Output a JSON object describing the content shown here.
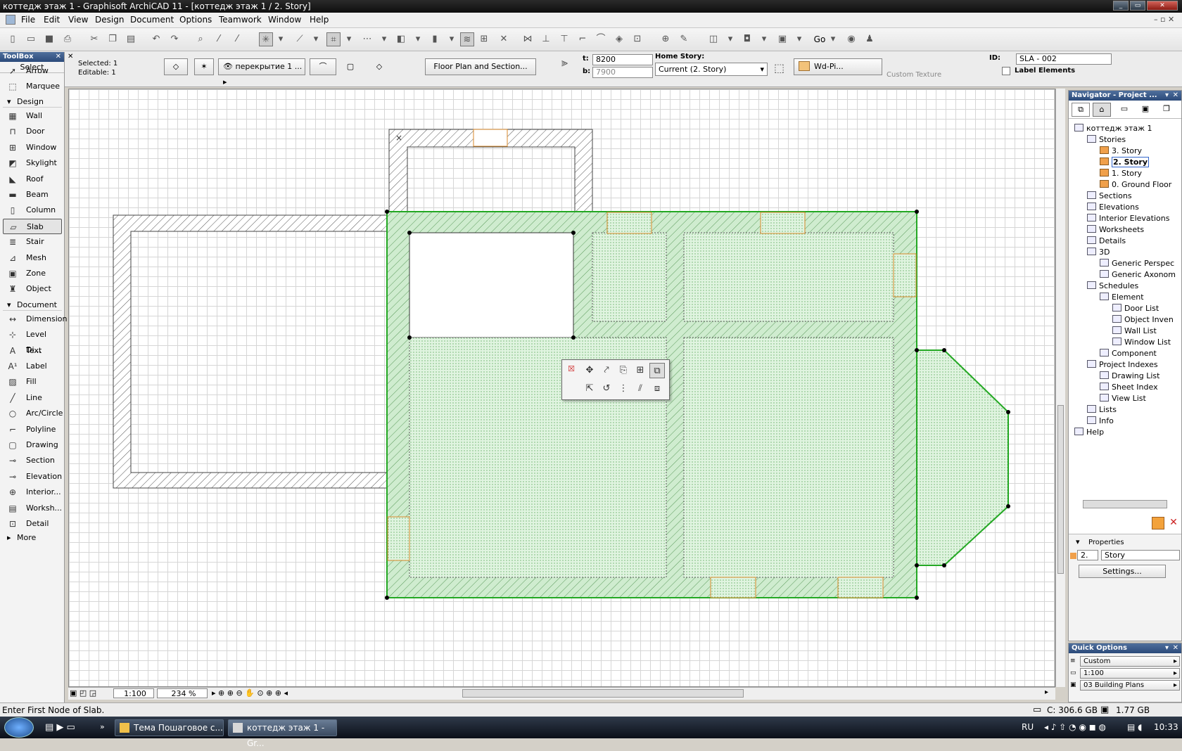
{
  "window": {
    "title": "коттедж этаж 1 - Graphisoft ArchiCAD 11 - [коттедж этаж 1 / 2. Story]"
  },
  "menu": [
    "File",
    "Edit",
    "View",
    "Design",
    "Document",
    "Options",
    "Teamwork",
    "Window",
    "Help"
  ],
  "toolbar": {
    "go_label": "Go"
  },
  "infobox": {
    "selected": "Selected: 1",
    "editable": "Editable: 1",
    "layer": "перекрытие 1 ...",
    "floor_plan_button": "Floor Plan and Section...",
    "t_label": "t:",
    "t_value": "8200",
    "b_label": "b:",
    "b_value": "7900",
    "home_story_label": "Home Story:",
    "home_story_value": "Current (2. Story)",
    "material": "Wd-Pi...",
    "custom_texture": "Custom Texture",
    "id_label": "ID:",
    "id_value": "SLA - 002",
    "label_elements": "Label Elements"
  },
  "toolbox": {
    "title": "ToolBox",
    "select": "Select",
    "select_tools": [
      {
        "label": "Arrow",
        "icon": "arrow-icon"
      },
      {
        "label": "Marquee",
        "icon": "marquee-icon"
      }
    ],
    "design_group": "Design",
    "design_tools": [
      {
        "label": "Wall",
        "icon": "wall-icon"
      },
      {
        "label": "Door",
        "icon": "door-icon"
      },
      {
        "label": "Window",
        "icon": "window-icon"
      },
      {
        "label": "Skylight",
        "icon": "skylight-icon"
      },
      {
        "label": "Roof",
        "icon": "roof-icon"
      },
      {
        "label": "Beam",
        "icon": "beam-icon"
      },
      {
        "label": "Column",
        "icon": "column-icon"
      },
      {
        "label": "Slab",
        "icon": "slab-icon"
      },
      {
        "label": "Stair",
        "icon": "stair-icon"
      },
      {
        "label": "Mesh",
        "icon": "mesh-icon"
      },
      {
        "label": "Zone",
        "icon": "zone-icon"
      },
      {
        "label": "Object",
        "icon": "object-icon"
      }
    ],
    "document_group": "Document",
    "document_tools": [
      {
        "label": "Dimension",
        "icon": "dimension-icon"
      },
      {
        "label": "Level Di...",
        "icon": "level-dimension-icon"
      },
      {
        "label": "Text",
        "icon": "text-icon"
      },
      {
        "label": "Label",
        "icon": "label-icon"
      },
      {
        "label": "Fill",
        "icon": "fill-icon"
      },
      {
        "label": "Line",
        "icon": "line-icon"
      },
      {
        "label": "Arc/Circle",
        "icon": "arc-circle-icon"
      },
      {
        "label": "Polyline",
        "icon": "polyline-icon"
      },
      {
        "label": "Drawing",
        "icon": "drawing-icon"
      },
      {
        "label": "Section",
        "icon": "section-icon"
      },
      {
        "label": "Elevation",
        "icon": "elevation-icon"
      },
      {
        "label": "Interior...",
        "icon": "interior-elevation-icon"
      },
      {
        "label": "Worksh...",
        "icon": "worksheet-icon"
      },
      {
        "label": "Detail",
        "icon": "detail-icon"
      }
    ],
    "more": "More"
  },
  "navigator": {
    "title": "Navigator - Project ...",
    "items": [
      {
        "label": "коттедж этаж 1"
      },
      {
        "label": "Stories"
      },
      {
        "label": "3. Story"
      },
      {
        "label": "2. Story"
      },
      {
        "label": "1. Story"
      },
      {
        "label": "0. Ground Floor"
      },
      {
        "label": "Sections"
      },
      {
        "label": "Elevations"
      },
      {
        "label": "Interior Elevations"
      },
      {
        "label": "Worksheets"
      },
      {
        "label": "Details"
      },
      {
        "label": "3D"
      },
      {
        "label": "Generic Perspec"
      },
      {
        "label": "Generic Axonom"
      },
      {
        "label": "Schedules"
      },
      {
        "label": "Element"
      },
      {
        "label": "Door List"
      },
      {
        "label": "Object Inven"
      },
      {
        "label": "Wall List"
      },
      {
        "label": "Window List"
      },
      {
        "label": "Component"
      },
      {
        "label": "Project Indexes"
      },
      {
        "label": "Drawing List"
      },
      {
        "label": "Sheet Index"
      },
      {
        "label": "View List"
      },
      {
        "label": "Lists"
      },
      {
        "label": "Info"
      },
      {
        "label": "Help"
      }
    ],
    "properties_label": "Properties",
    "prop_number": "2.",
    "prop_name": "Story",
    "settings_button": "Settings..."
  },
  "quick_options": {
    "title": "Quick Options",
    "values": [
      "Custom",
      "1:100",
      "03 Building Plans"
    ]
  },
  "canvas": {
    "scale": "1:100",
    "zoom": "234 %"
  },
  "status": {
    "message": "Enter First Node of Slab.",
    "disk": "C: 306.6 GB",
    "memory": "1.77 GB"
  },
  "taskbar": {
    "tasks": [
      "Тема Пошаговое с...",
      "коттедж этаж 1 - Gr..."
    ],
    "lang": "RU",
    "time": "10:33"
  }
}
